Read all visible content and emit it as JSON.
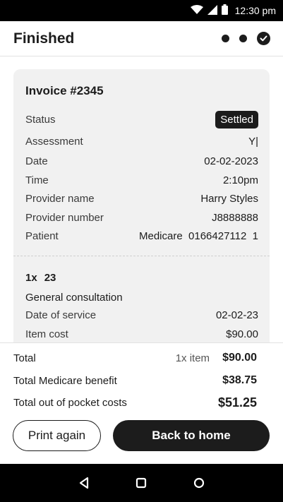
{
  "statusbar": {
    "time": "12:30 pm",
    "icons": [
      "wifi-icon",
      "cellular-icon",
      "battery-icon"
    ]
  },
  "header": {
    "title": "Finished",
    "steps": [
      "step-dot",
      "step-dot",
      "step-complete-check"
    ]
  },
  "invoice": {
    "title": "Invoice #2345",
    "details": [
      {
        "label": "Status",
        "value": "Settled",
        "badge": true
      },
      {
        "label": "Assessment",
        "value": "Y|"
      },
      {
        "label": "Date",
        "value": "02-02-2023"
      },
      {
        "label": "Time",
        "value": "2:10pm"
      },
      {
        "label": "Provider name",
        "value": "Harry Styles"
      },
      {
        "label": "Provider number",
        "value": "J8888888"
      },
      {
        "label": "Patient",
        "value": "Medicare  0166427112  1"
      }
    ],
    "item": {
      "quantity": "1x",
      "code": "23",
      "name": "General consultation",
      "details": [
        {
          "label": "Date of service",
          "value": "02-02-23"
        },
        {
          "label": "Item cost",
          "value": "$90.00"
        }
      ]
    }
  },
  "summary": {
    "total_label": "Total",
    "total_count": "1x item",
    "total_amount": "$90.00",
    "benefit_label": "Total Medicare benefit",
    "benefit_amount": "$38.75",
    "oop_label": "Total out of pocket costs",
    "oop_amount": "$51.25"
  },
  "actions": {
    "print_label": "Print again",
    "home_label": "Back to home"
  },
  "navbar": {
    "icons": [
      "back-icon",
      "home-icon",
      "recents-icon"
    ]
  },
  "colors": {
    "primary": "#1c1c1c",
    "card_bg": "#f1f1f1",
    "background": "#ffffff"
  }
}
